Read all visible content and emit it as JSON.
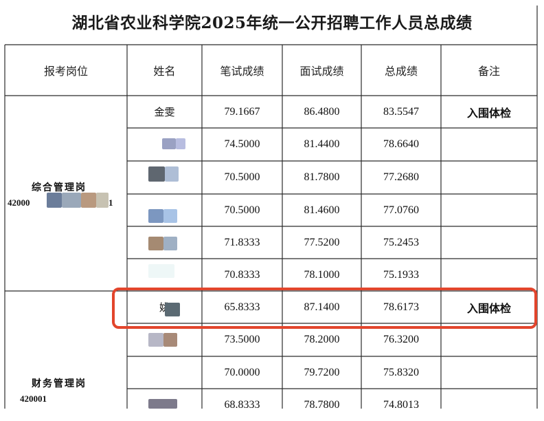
{
  "title": "湖北省农业科学院2025年统一公开招聘工作人员总成绩",
  "headers": {
    "post": "报考岗位",
    "name": "姓名",
    "written": "笔试成绩",
    "interview": "面试成绩",
    "total": "总成绩",
    "remark": "备注"
  },
  "groups": [
    {
      "post": "综合管理岗",
      "code": "42000",
      "code_tail": "1"
    },
    {
      "post": "财务管理岗",
      "code": "420001"
    }
  ],
  "rows": [
    {
      "name": "金雯",
      "written": "79.1667",
      "interview": "86.4800",
      "total": "83.5547",
      "remark": "入围体检"
    },
    {
      "name": "",
      "written": "74.5000",
      "interview": "81.4400",
      "total": "78.6640",
      "remark": ""
    },
    {
      "name": "",
      "written": "70.5000",
      "interview": "81.7800",
      "total": "77.2680",
      "remark": ""
    },
    {
      "name": "",
      "written": "70.5000",
      "interview": "81.4600",
      "total": "77.0760",
      "remark": ""
    },
    {
      "name": "",
      "written": "71.8333",
      "interview": "77.5200",
      "total": "75.2453",
      "remark": ""
    },
    {
      "name": "",
      "written": "70.8333",
      "interview": "78.1000",
      "total": "75.1933",
      "remark": ""
    },
    {
      "name": "姚",
      "written": "65.8333",
      "interview": "87.1400",
      "total": "78.6173",
      "remark": "入围体检"
    },
    {
      "name": "",
      "written": "73.5000",
      "interview": "78.2000",
      "total": "76.3200",
      "remark": ""
    },
    {
      "name": "",
      "written": "70.0000",
      "interview": "79.7200",
      "total": "75.8320",
      "remark": ""
    },
    {
      "name": "",
      "written": "68.8333",
      "interview": "78.7800",
      "total": "74.8013",
      "remark": ""
    }
  ],
  "colors": {
    "border": "#2b2b2b",
    "highlight": "#e2452c"
  }
}
